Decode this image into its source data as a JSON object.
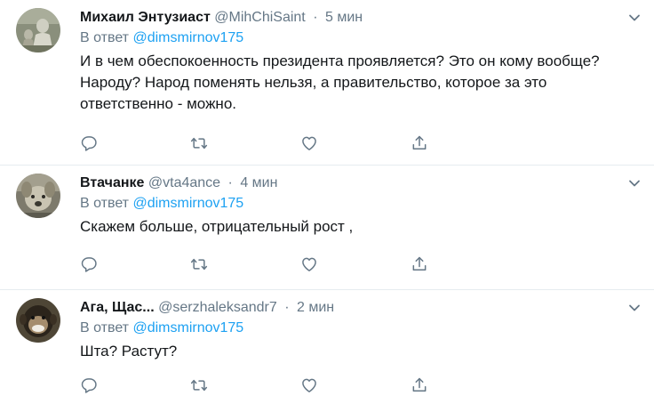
{
  "tweets": [
    {
      "name": "Михаил Энтузиаст",
      "handle": "@MihChiSaint",
      "separator": "·",
      "time": "5 мин",
      "reply_prefix": "В ответ",
      "reply_mention": "@dimsmirnov175",
      "text": "И в чем обеспокоенность президента проявляется? Это он кому вообще? Народу? Народ поменять нельзя, а правительство, которое за это ответственно - можно.",
      "avatar_icon": "avatar-photo-statue-icon"
    },
    {
      "name": "Втачанке",
      "handle": "@vta4ance",
      "separator": "·",
      "time": "4 мин",
      "reply_prefix": "В ответ",
      "reply_mention": "@dimsmirnov175",
      "text": "Скажем больше, отрицательный рост ,",
      "avatar_icon": "avatar-photo-dog-icon"
    },
    {
      "name": "Ага, Щас...",
      "handle": "@serzhaleksandr7",
      "separator": "·",
      "time": "2 мин",
      "reply_prefix": "В ответ",
      "reply_mention": "@dimsmirnov175",
      "text": "Шта? Растут?",
      "avatar_icon": "avatar-photo-monkey-icon"
    }
  ],
  "icons": {
    "reply": "reply-icon",
    "retweet": "retweet-icon",
    "like": "like-icon",
    "share": "share-icon",
    "menu": "chevron-down-icon"
  },
  "colors": {
    "text": "#14171a",
    "secondary": "#657786",
    "link": "#1da1f2",
    "divider": "#e6ecf0"
  }
}
